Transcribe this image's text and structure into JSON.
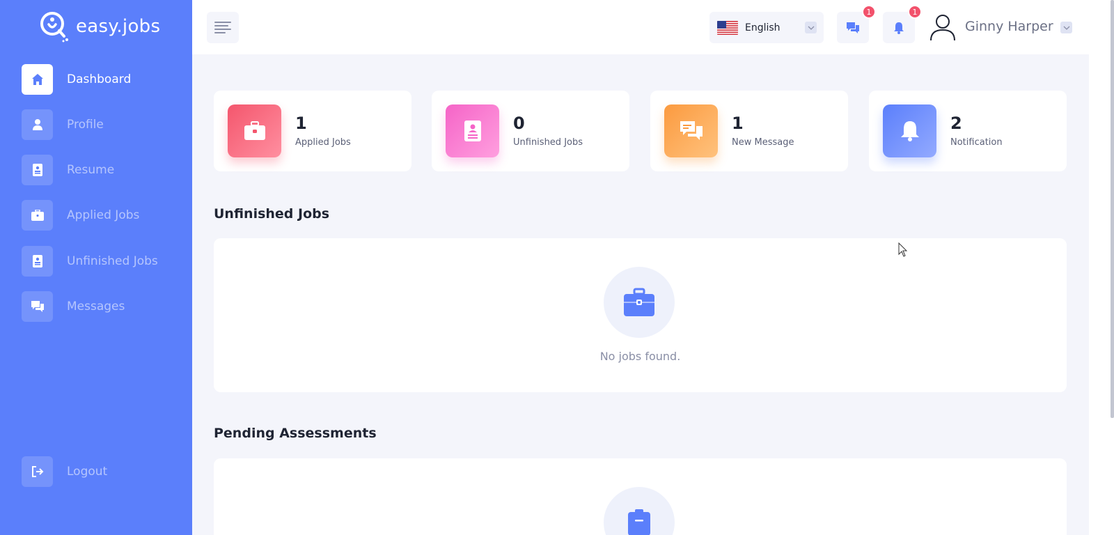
{
  "app": {
    "name": "easy.jobs"
  },
  "sidebar": {
    "items": [
      {
        "label": "Dashboard",
        "icon": "home-icon",
        "active": true
      },
      {
        "label": "Profile",
        "icon": "user-icon"
      },
      {
        "label": "Resume",
        "icon": "resume-icon"
      },
      {
        "label": "Applied Jobs",
        "icon": "briefcase-icon"
      },
      {
        "label": "Unfinished Jobs",
        "icon": "document-icon"
      },
      {
        "label": "Messages",
        "icon": "messages-icon"
      }
    ],
    "logout": {
      "label": "Logout",
      "icon": "logout-icon"
    }
  },
  "header": {
    "language": "English",
    "messages_badge": "1",
    "notifications_badge": "1",
    "user_name": "Ginny Harper"
  },
  "stats": [
    {
      "value": "1",
      "label": "Applied Jobs",
      "icon": "briefcase-icon",
      "color": "#f4566d"
    },
    {
      "value": "0",
      "label": "Unfinished Jobs",
      "icon": "document-icon",
      "color": "#f564c7"
    },
    {
      "value": "1",
      "label": "New Message",
      "icon": "messages-icon",
      "color": "#fb9a3f"
    },
    {
      "value": "2",
      "label": "Notification",
      "icon": "bell-icon",
      "color": "#5b7ffb"
    }
  ],
  "sections": {
    "unfinished": {
      "title": "Unfinished Jobs",
      "empty_text": "No jobs found."
    },
    "assessments": {
      "title": "Pending Assessments"
    }
  },
  "colors": {
    "sidebar": "#5b7ffb",
    "background": "#f4f5fb",
    "badge": "#f2516b"
  }
}
